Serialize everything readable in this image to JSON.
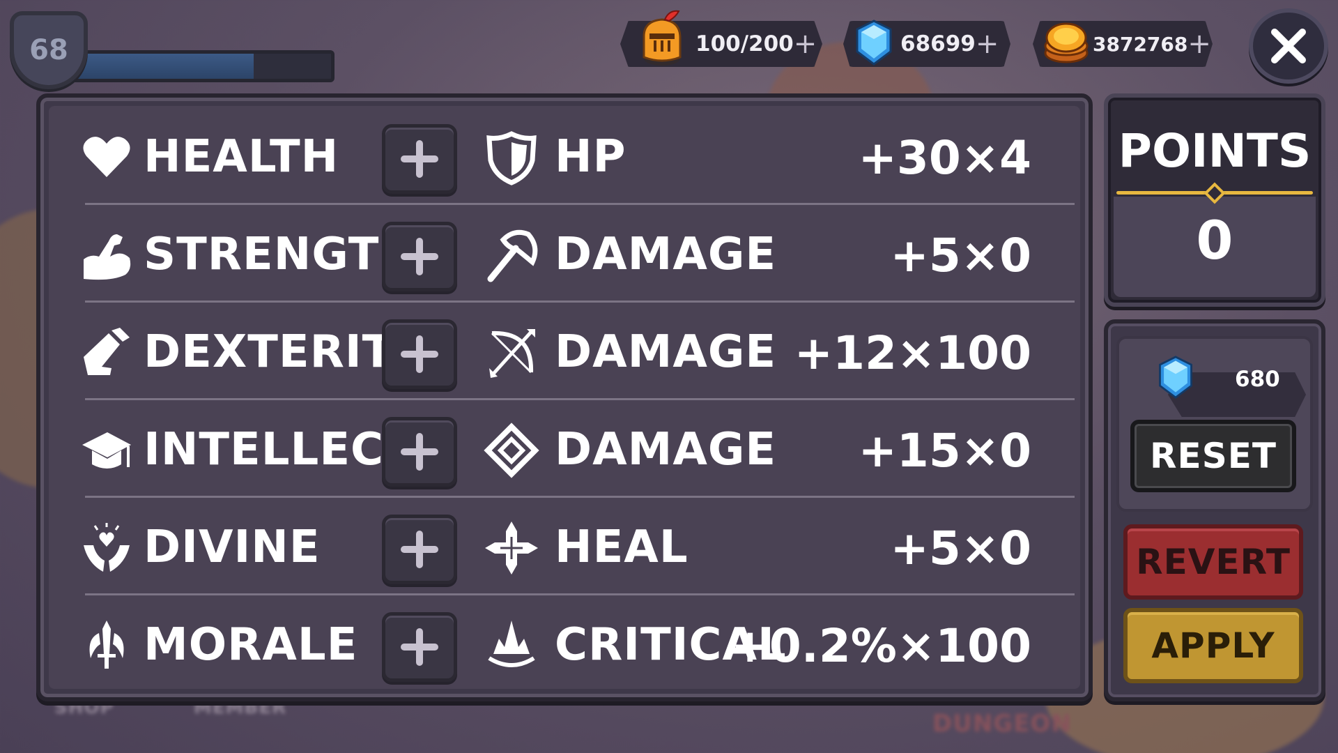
{
  "player": {
    "level": "68",
    "xp_progress": 0.7
  },
  "currencies": {
    "stamina": {
      "value": "100/200",
      "plus": "+",
      "icon": "knight-helmet-icon"
    },
    "gems": {
      "value": "68699",
      "plus": "+",
      "icon": "blue-gem-icon"
    },
    "gold": {
      "value": "3872768",
      "plus": "+",
      "icon": "gold-coin-stack-icon"
    }
  },
  "close": {
    "icon": "close-icon"
  },
  "stats": [
    {
      "attribute": "HEALTH",
      "attribute_icon": "heart-icon",
      "add": "+",
      "effect": "HP",
      "effect_icon": "shield-icon",
      "value": "+30×4"
    },
    {
      "attribute": "STRENGTH",
      "attribute_icon": "flexed-arm-icon",
      "add": "+",
      "effect": "DAMAGE",
      "effect_icon": "axe-icon",
      "value": "+5×0"
    },
    {
      "attribute": "DEXTERITY",
      "attribute_icon": "feather-quill-icon",
      "add": "+",
      "effect": "DAMAGE",
      "effect_icon": "bow-arrow-icon",
      "value": "+12×100"
    },
    {
      "attribute": "INTELLECT",
      "attribute_icon": "graduation-cap-icon",
      "add": "+",
      "effect": "DAMAGE",
      "effect_icon": "rune-diamond-icon",
      "value": "+15×0"
    },
    {
      "attribute": "DIVINE",
      "attribute_icon": "praying-hands-icon",
      "add": "+",
      "effect": "HEAL",
      "effect_icon": "holy-cross-icon",
      "value": "+5×0"
    },
    {
      "attribute": "MORALE",
      "attribute_icon": "sword-wings-icon",
      "add": "+",
      "effect": "CRITICAL",
      "effect_icon": "crown-burst-icon",
      "value": "+0.2%×100"
    }
  ],
  "points": {
    "title": "POINTS",
    "value": "0"
  },
  "actions": {
    "cost": {
      "value": "680",
      "icon": "blue-gem-icon"
    },
    "reset_label": "RESET",
    "revert_label": "REVERT",
    "apply_label": "APPLY"
  },
  "background": {
    "bottom_labels": [
      "SHOP",
      "MEMBER",
      "DUNGEON"
    ]
  },
  "colors": {
    "panel": "#4a4254",
    "gold_accent": "#e8b840",
    "revert": "#9b2e30",
    "apply": "#c09632",
    "gem": "#4fb6ff"
  }
}
